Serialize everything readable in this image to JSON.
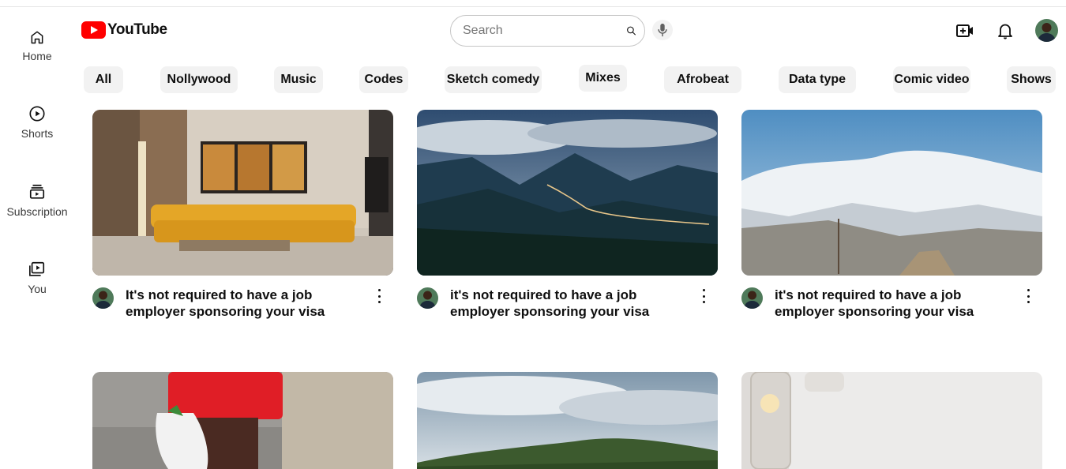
{
  "app": {
    "name": "YouTube"
  },
  "colors": {
    "brand_red": "#ff0000",
    "chip_bg": "#f2f2f2",
    "text": "#0f0f0f"
  },
  "sidebar": {
    "items": [
      {
        "label": "Home",
        "icon": "home-icon"
      },
      {
        "label": "Shorts",
        "icon": "shorts-icon"
      },
      {
        "label": "Subscription",
        "icon": "subscriptions-icon"
      },
      {
        "label": "You",
        "icon": "library-icon"
      }
    ]
  },
  "header": {
    "search_placeholder": "Search",
    "icons": [
      "search-icon",
      "mic-icon",
      "create-video-icon",
      "notifications-icon",
      "avatar"
    ]
  },
  "chips": [
    "All",
    "Nollywood",
    "Music",
    "Codes",
    "Sketch comedy",
    "Mixes",
    "Afrobeat",
    "Data type",
    "Comic video",
    "Shows"
  ],
  "videos": [
    {
      "title": "It's not required to have a job employer sponsoring your visa",
      "thumbnail": "living-room-tiger-art"
    },
    {
      "title": "it's not required to have a job employer sponsoring your visa",
      "thumbnail": "mountain-valley-road"
    },
    {
      "title": "it's not required to have a job employer sponsoring your visa",
      "thumbnail": "snowy-mountains"
    },
    {
      "thumbnail": "person-red-jacket-shopping-bag"
    },
    {
      "thumbnail": "green-hills-cloudy-sky"
    },
    {
      "thumbnail": "hanging-light-bulbs"
    }
  ]
}
